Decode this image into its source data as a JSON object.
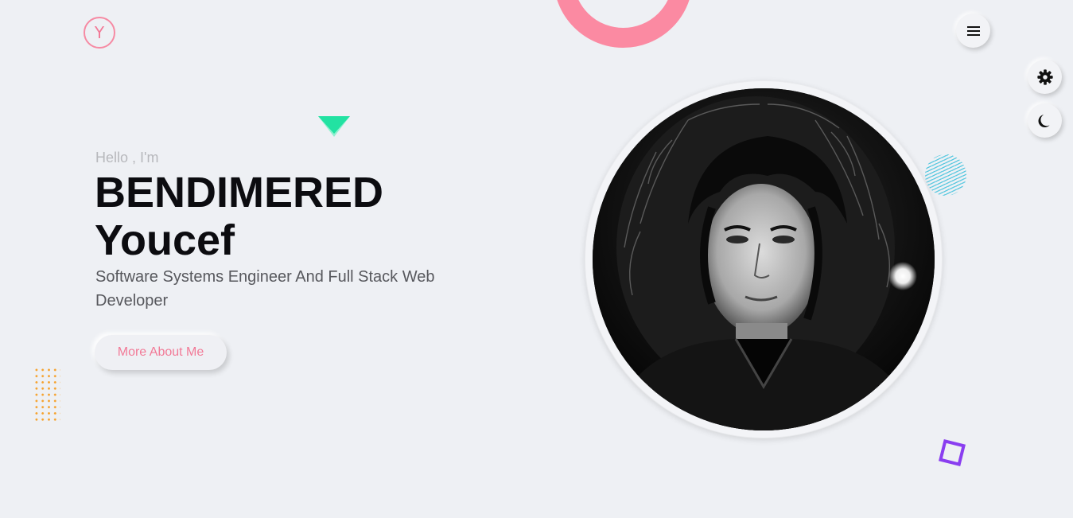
{
  "brand": {
    "logo_letter": "Y",
    "accent_color": "#f27a97"
  },
  "header": {
    "menu_icon": "hamburger-menu-icon"
  },
  "side_controls": {
    "settings_icon": "gear-icon",
    "theme_icon": "moon-icon"
  },
  "hero": {
    "greeting": "Hello , I'm",
    "name_line1": "BENDIMERED",
    "name_line2": "Youcef",
    "subtitle": "Software Systems Engineer And Full Stack Web Developer",
    "cta_label": "More About Me"
  },
  "portrait": {
    "description_icon": "profile-photo"
  },
  "decorations": {
    "ring_color": "#fb8aa2",
    "triangle_color": "#2ee6a8",
    "dots_color": "#f6a12b",
    "striped_circle_color": "#5cc9e0",
    "square_color": "#8a3ef0"
  }
}
